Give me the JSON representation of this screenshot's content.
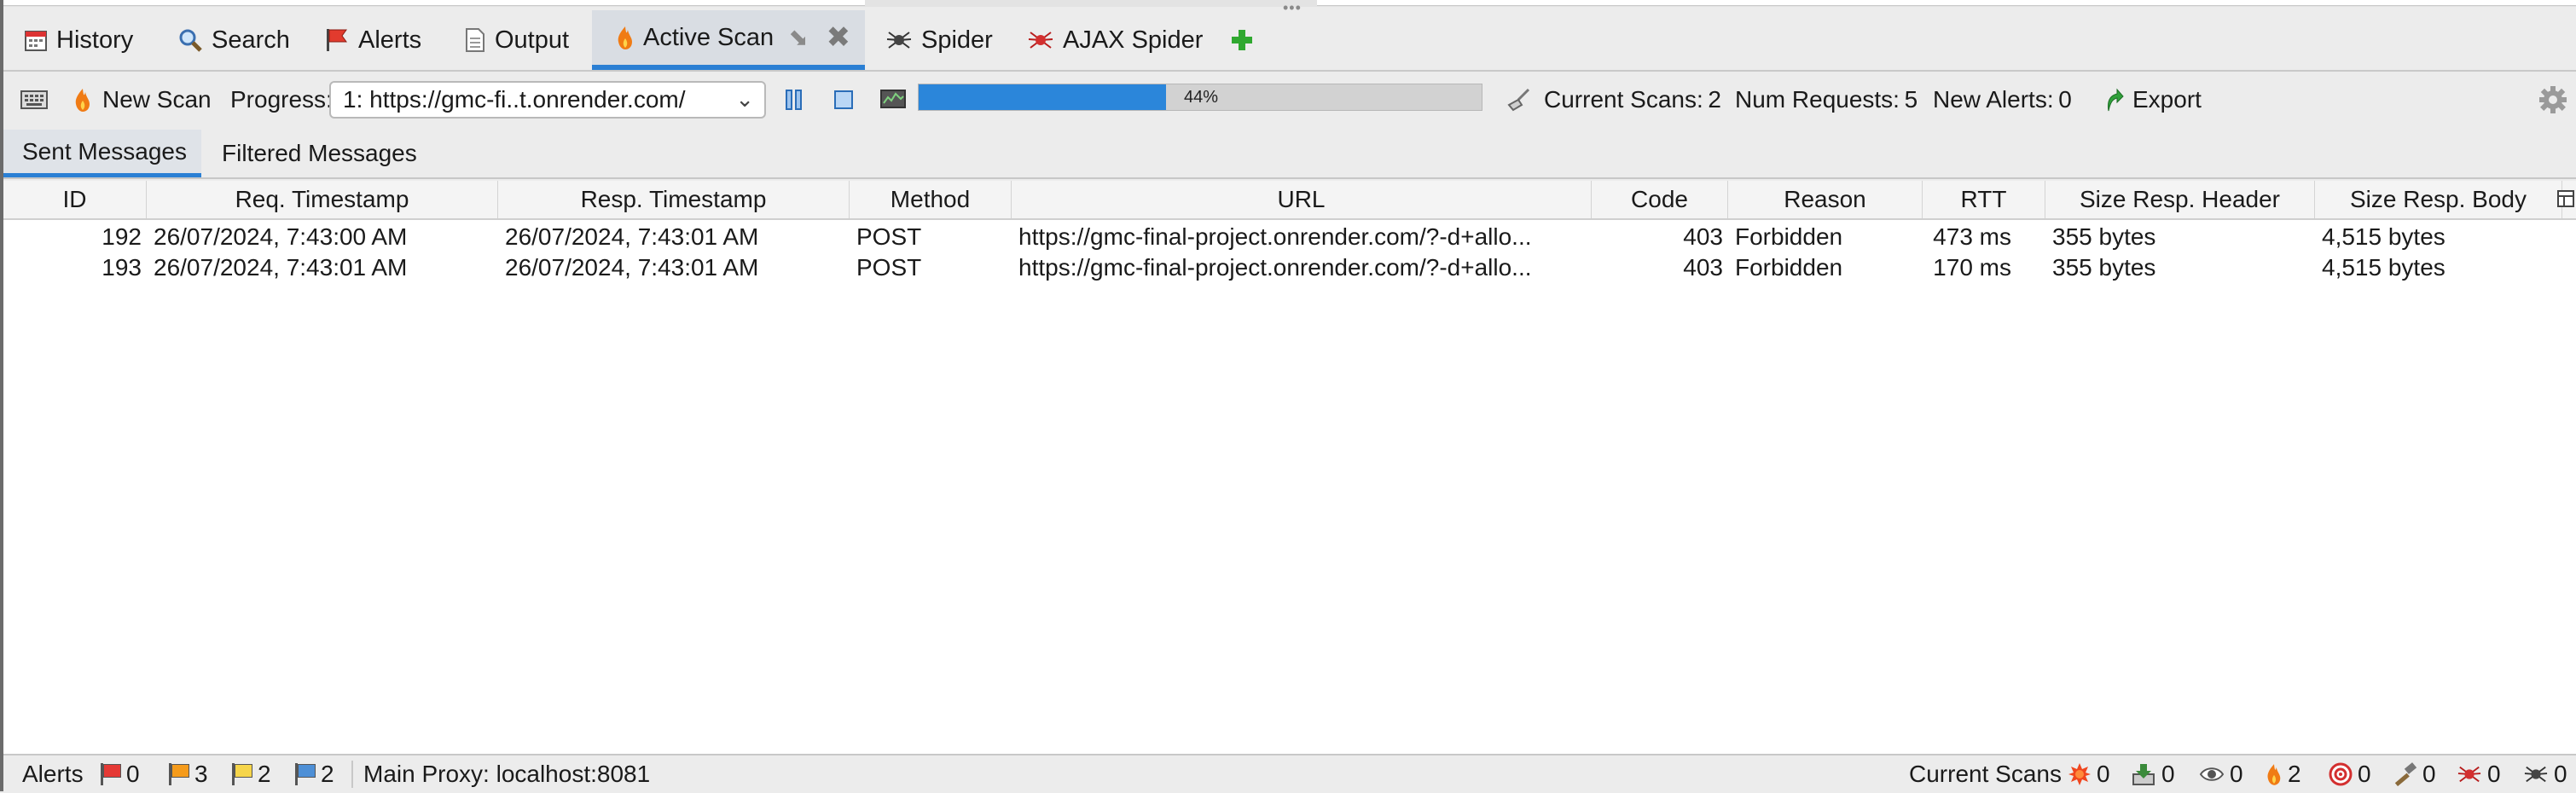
{
  "tabs": [
    {
      "label": "History",
      "icon": "calendar-icon"
    },
    {
      "label": "Search",
      "icon": "magnifier-icon"
    },
    {
      "label": "Alerts",
      "icon": "red-flag-icon"
    },
    {
      "label": "Output",
      "icon": "document-icon"
    },
    {
      "label": "Active Scan",
      "icon": "flame-icon",
      "active": true
    },
    {
      "label": "Spider",
      "icon": "spider-icon"
    },
    {
      "label": "AJAX Spider",
      "icon": "red-spider-icon"
    }
  ],
  "toolbar": {
    "new_scan": "New Scan",
    "progress_label": "Progress:",
    "progress_select": "1: https://gmc-fi..t.onrender.com/",
    "progress_percent": 44,
    "progress_text": "44%",
    "current_scans": "Current Scans: 2",
    "num_requests": "Num Requests: 5",
    "new_alerts": "New Alerts: 0",
    "export": "Export"
  },
  "subtabs": [
    "Sent Messages",
    "Filtered Messages"
  ],
  "table": {
    "columns": [
      "ID",
      "Req. Timestamp",
      "Resp. Timestamp",
      "Method",
      "URL",
      "Code",
      "Reason",
      "RTT",
      "Size Resp. Header",
      "Size Resp. Body"
    ],
    "rows": [
      {
        "id": "192",
        "req": "26/07/2024, 7:43:00 AM",
        "resp": "26/07/2024, 7:43:01 AM",
        "method": "POST",
        "url": "https://gmc-final-project.onrender.com/?-d+allo...",
        "code": "403",
        "reason": "Forbidden",
        "rtt": "473 ms",
        "hdr": "355 bytes",
        "body": "4,515 bytes"
      },
      {
        "id": "193",
        "req": "26/07/2024, 7:43:01 AM",
        "resp": "26/07/2024, 7:43:01 AM",
        "method": "POST",
        "url": "https://gmc-final-project.onrender.com/?-d+allo...",
        "code": "403",
        "reason": "Forbidden",
        "rtt": "170 ms",
        "hdr": "355 bytes",
        "body": "4,515 bytes"
      }
    ]
  },
  "status": {
    "alerts_label": "Alerts",
    "high": "0",
    "medium": "3",
    "low": "2",
    "info": "2",
    "proxy": "Main Proxy: localhost:8081",
    "current_scans_label": "Current Scans",
    "counts": [
      "0",
      "0",
      "0",
      "2",
      "0",
      "0",
      "0",
      "0"
    ]
  },
  "colors": {
    "accent": "#2a7fd4",
    "progress": "#2b86da",
    "high": "#e53935",
    "medium": "#f59b1b",
    "low": "#f6d54a",
    "info": "#4d8fd6"
  }
}
